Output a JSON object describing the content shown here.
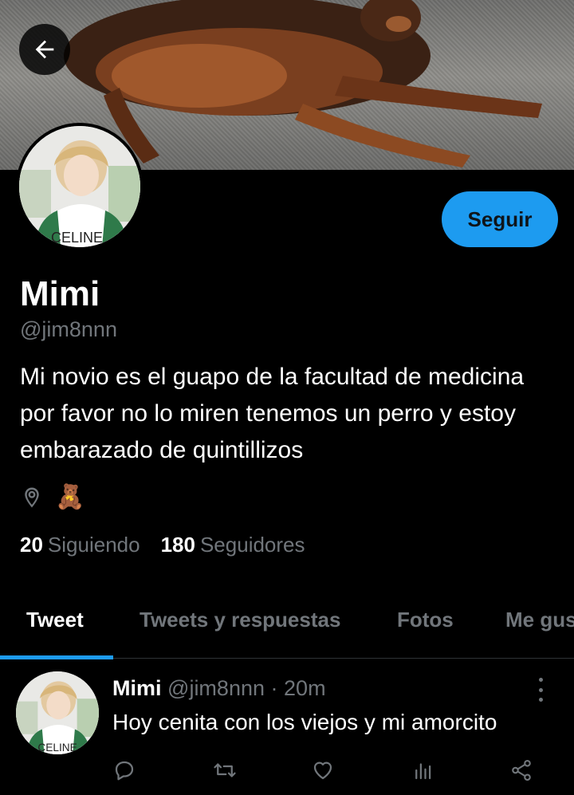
{
  "header": {
    "back_icon": "arrow-left-icon"
  },
  "profile": {
    "name": "Mimi",
    "handle": "@jim8nnn",
    "bio": "Mi novio es el guapo de la facultad de medicina por favor no lo miren tenemos un perro y estoy embarazado de quintillizos",
    "location_icon": "map-pin-icon",
    "location_emoji": "🧸",
    "avatar_shirt_text": "CELINE",
    "follow_label": "Seguir"
  },
  "stats": {
    "following_count": "20",
    "following_label": "Siguiendo",
    "followers_count": "180",
    "followers_label": "Seguidores"
  },
  "tabs": [
    {
      "label": "Tweet",
      "active": true
    },
    {
      "label": "Tweets y respuestas",
      "active": false
    },
    {
      "label": "Fotos",
      "active": false
    },
    {
      "label": "Me gus",
      "active": false
    }
  ],
  "tweet": {
    "name": "Mimi",
    "handle": "@jim8nnn",
    "separator": "·",
    "time": "20m",
    "text": "Hoy cenita con los viejos y mi amorcito",
    "avatar_shirt_text": "CELINE",
    "actions": [
      "reply-icon",
      "retweet-icon",
      "like-icon",
      "stats-icon",
      "share-icon"
    ]
  },
  "colors": {
    "accent": "#1d9bf0",
    "background": "#000000",
    "muted": "#71767b"
  }
}
